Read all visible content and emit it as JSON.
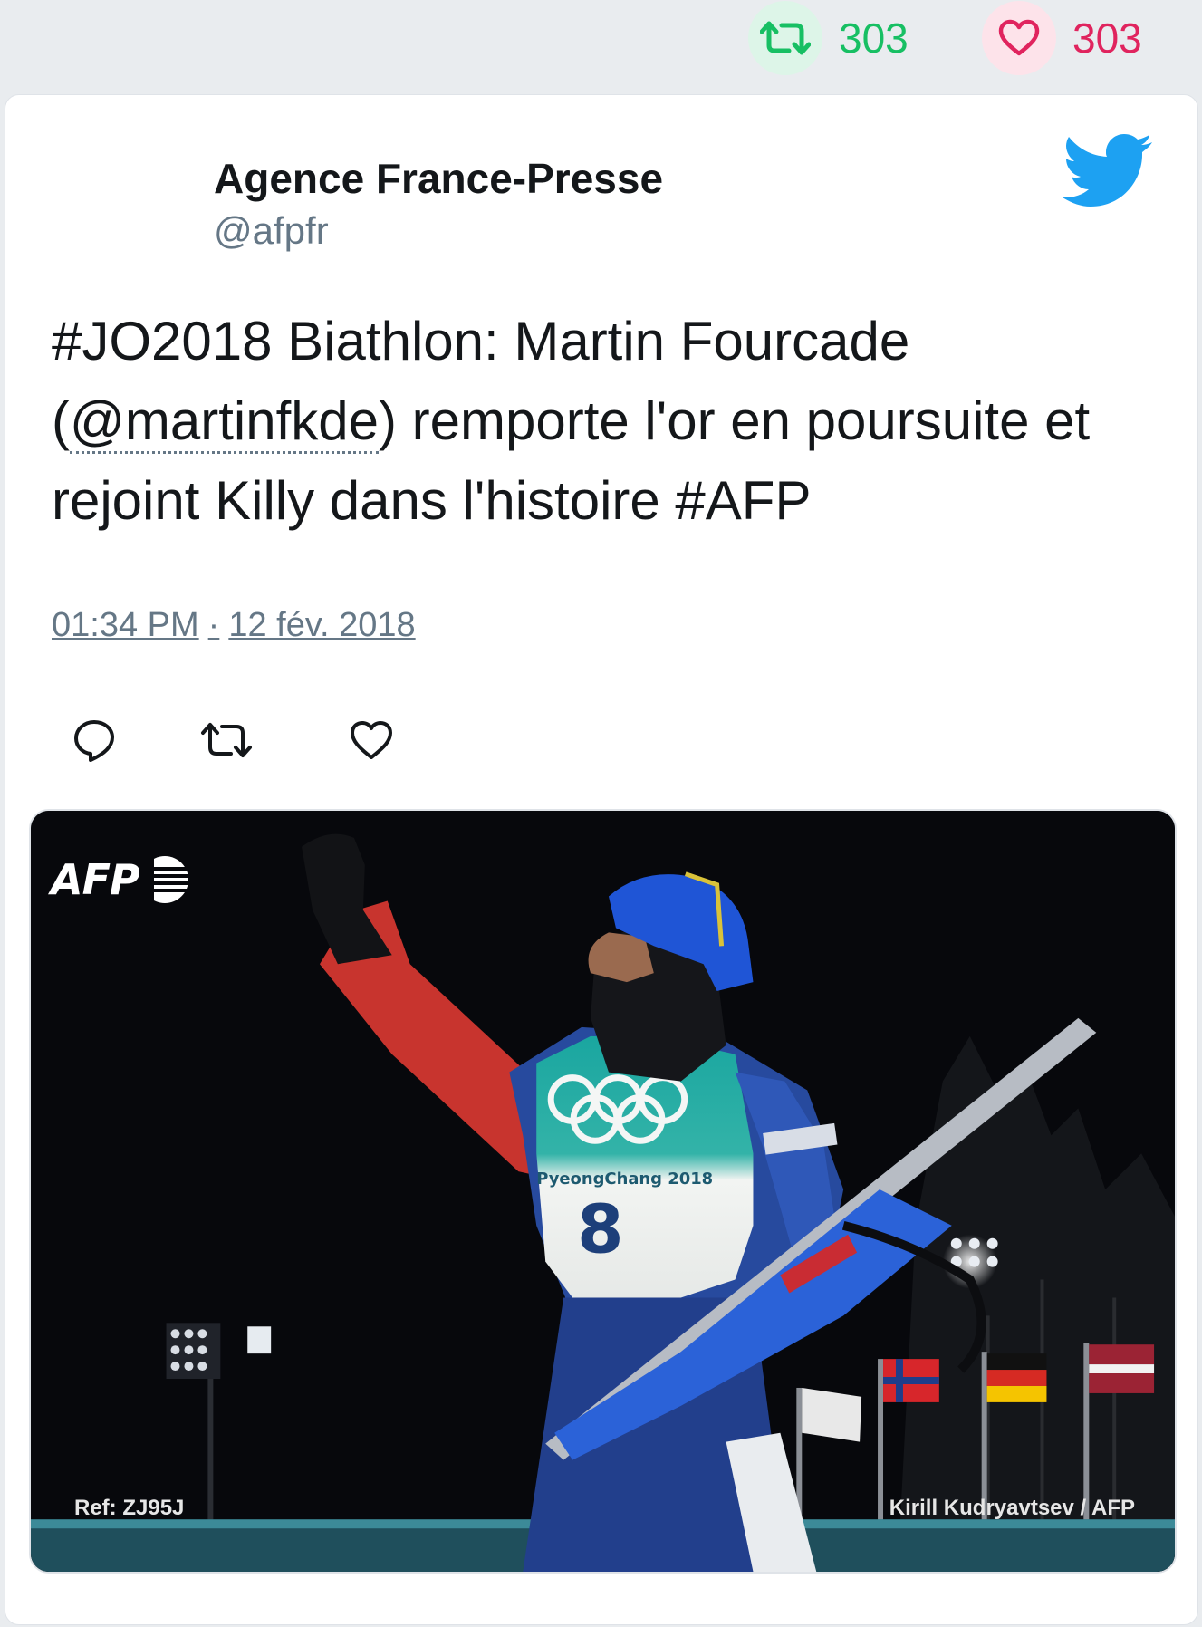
{
  "counters": {
    "retweet_count": "303",
    "like_count": "303",
    "retweet_color": "#17bf63",
    "like_color": "#e0245e"
  },
  "tweet": {
    "author_name": "Agence France-Presse",
    "author_handle": "@afpfr",
    "text_before": "#JO2018 Biathlon: Martin Fourcade (",
    "mention": "@martinfkde",
    "text_after": ") remporte l'or en poursuite et rejoint Killy dans l'histoire #AFP",
    "time": "01:34 PM",
    "separator": "·",
    "date": "12 fév. 2018",
    "icons": [
      "reply-icon",
      "retweet-icon",
      "like-icon",
      "twitter-bird-icon"
    ]
  },
  "media": {
    "logo_text": "AFP",
    "ref_caption": "Ref: ZJ95J",
    "credit_caption": "Kirill Kudryavtsev / AFP",
    "bib_number": "8",
    "bib_text": "PyeongChang 2018"
  }
}
